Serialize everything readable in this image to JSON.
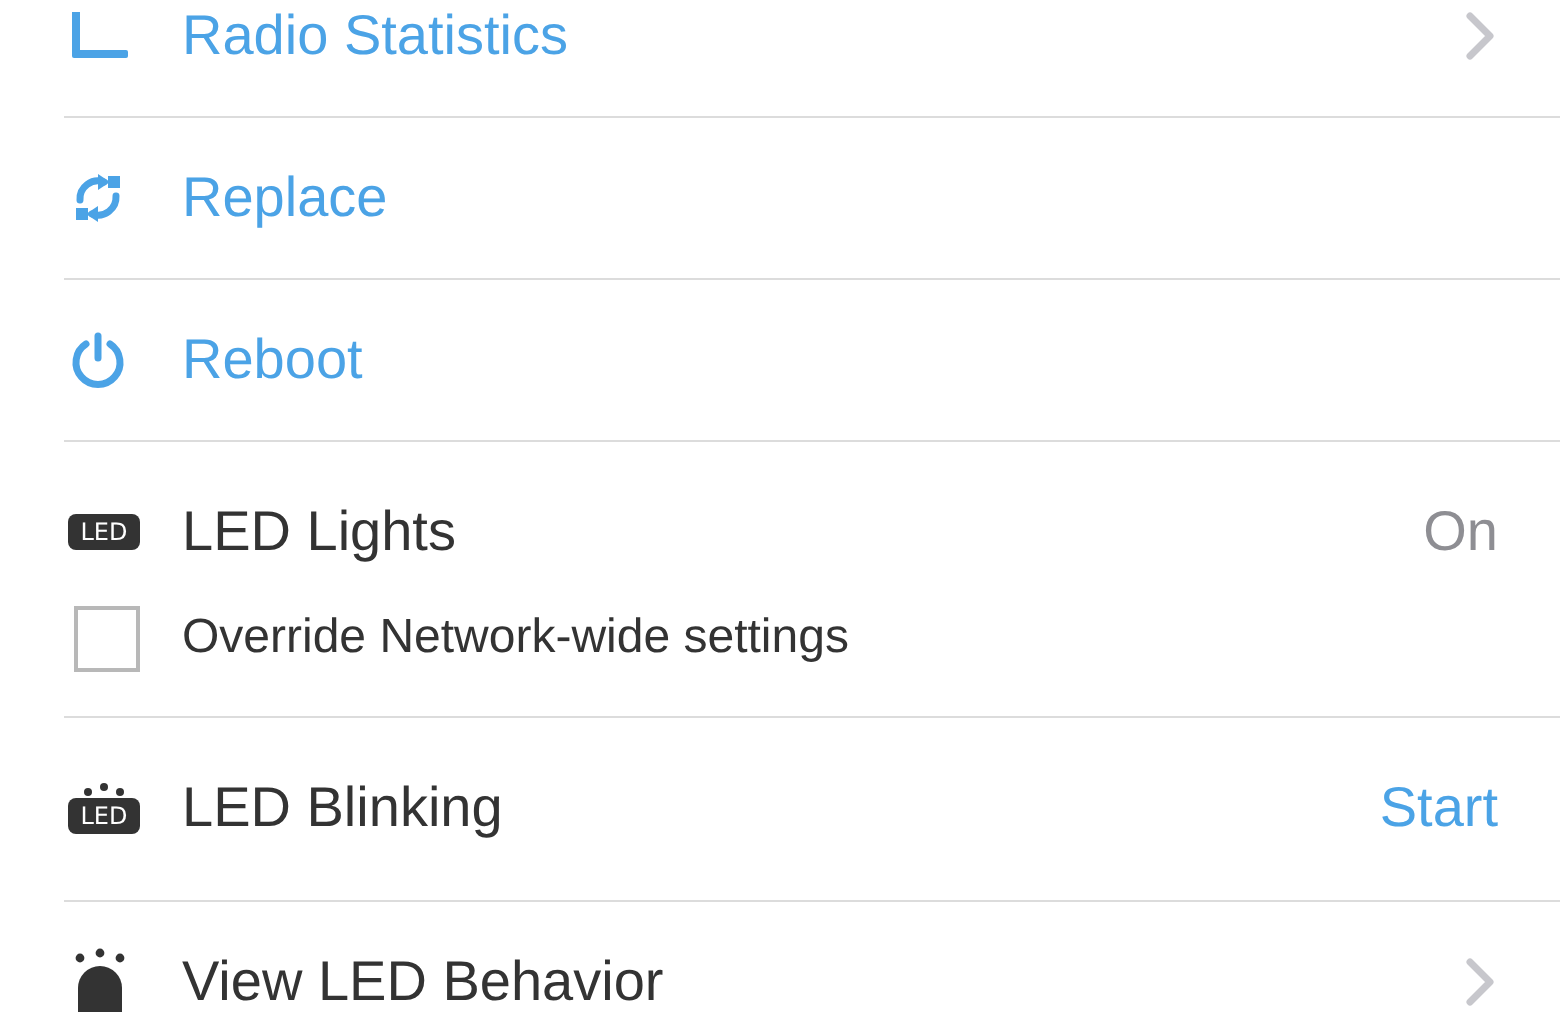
{
  "rows": [
    {
      "kind": "stats",
      "label": "Radio Statistics",
      "accent": true,
      "chevron": true
    },
    {
      "kind": "replace",
      "label": "Replace",
      "accent": true
    },
    {
      "kind": "reboot",
      "label": "Reboot",
      "accent": true
    },
    {
      "kind": "led",
      "badge": "LED",
      "label": "LED Lights",
      "accent": false,
      "value": "On",
      "option": {
        "label": "Override Network-wide settings",
        "checked": false
      }
    },
    {
      "kind": "blink",
      "badge": "LED",
      "label": "LED Blinking",
      "accent": false,
      "button": "Start"
    },
    {
      "kind": "behavior",
      "label": "View LED Behavior",
      "accent": false,
      "chevron": true
    }
  ]
}
